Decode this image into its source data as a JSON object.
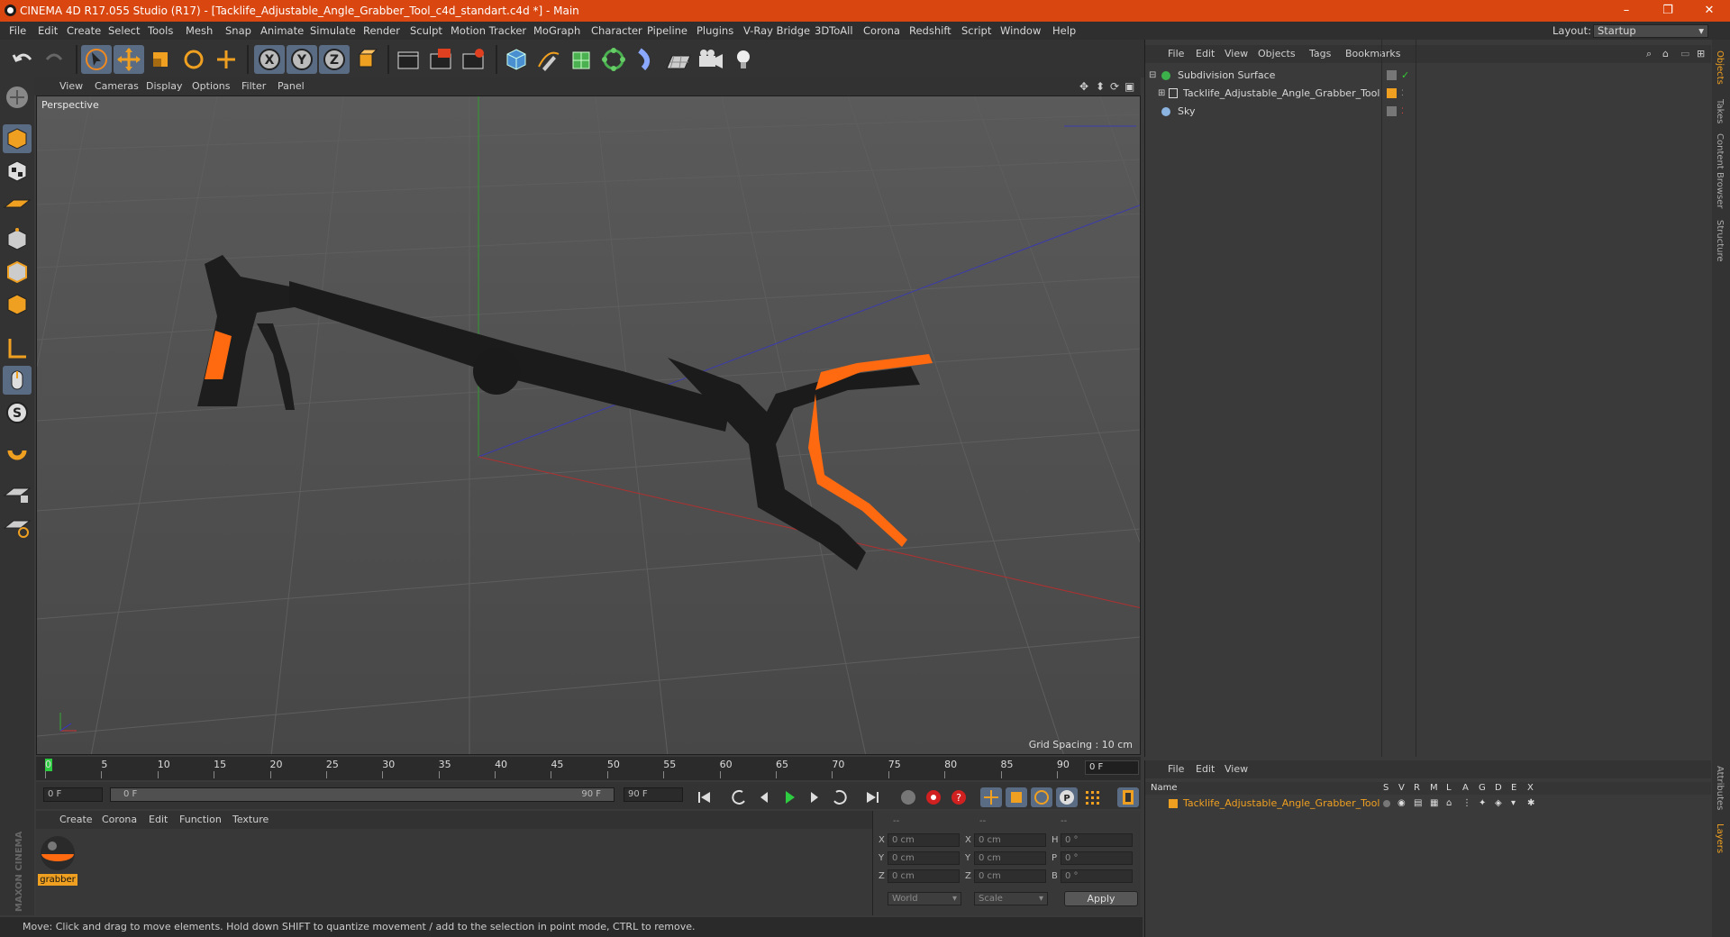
{
  "window": {
    "title": "CINEMA 4D R17.055 Studio (R17) - [Tacklife_Adjustable_Angle_Grabber_Tool_c4d_standart.c4d *] - Main",
    "minimize": "–",
    "restore": "❐",
    "close": "✕"
  },
  "menu": {
    "items": [
      "File",
      "Edit",
      "Create",
      "Select",
      "Tools",
      "Mesh",
      "Snap",
      "Animate",
      "Simulate",
      "Render",
      "Sculpt",
      "Motion Tracker",
      "MoGraph",
      "Character",
      "Pipeline",
      "Plugins",
      "V-Ray Bridge",
      "3DToAll",
      "Corona",
      "Redshift",
      "Script",
      "Window",
      "Help"
    ],
    "layout_label": "Layout:",
    "layout_value": "Startup"
  },
  "toolbar": {
    "icons": [
      "undo-icon",
      "redo-icon",
      "select-arrow-icon",
      "move-icon",
      "scale-icon",
      "rotate-icon",
      "last-tool-icon",
      "x-axis-icon",
      "y-axis-icon",
      "z-axis-icon",
      "coordinate-system-icon",
      "render-view-icon",
      "render-picture-viewer-icon",
      "render-settings-icon",
      "cube-icon",
      "pen-icon",
      "subdivision-icon",
      "array-icon",
      "deformer-icon",
      "floor-icon",
      "camera-icon",
      "light-icon"
    ],
    "axis_x": "X",
    "axis_y": "Y",
    "axis_z": "Z"
  },
  "viewport": {
    "menu": [
      "View",
      "Cameras",
      "Display",
      "Options",
      "Filter",
      "Panel"
    ],
    "label": "Perspective",
    "grid_spacing": "Grid Spacing : 10 cm"
  },
  "timeline": {
    "ticks": [
      "0",
      "5",
      "10",
      "15",
      "20",
      "25",
      "30",
      "35",
      "40",
      "45",
      "50",
      "55",
      "60",
      "65",
      "70",
      "75",
      "80",
      "85",
      "90"
    ],
    "current_frame": "0 F",
    "start_field": "0 F",
    "range_start": "0 F",
    "range_end": "90 F",
    "end_field": "90 F"
  },
  "materials": {
    "menu": [
      "Create",
      "Corona",
      "Edit",
      "Function",
      "Texture"
    ],
    "items": [
      {
        "name": "grabber"
      }
    ]
  },
  "coordinates": {
    "header": [
      "--",
      "--",
      "--"
    ],
    "rows": [
      {
        "a": "X",
        "av": "0 cm",
        "b": "X",
        "bv": "0 cm",
        "c": "H",
        "cv": "0 °"
      },
      {
        "a": "Y",
        "av": "0 cm",
        "b": "Y",
        "bv": "0 cm",
        "c": "P",
        "cv": "0 °"
      },
      {
        "a": "Z",
        "av": "0 cm",
        "b": "Z",
        "bv": "0 cm",
        "c": "B",
        "cv": "0 °"
      }
    ],
    "mode1": "World",
    "mode2": "Scale",
    "apply": "Apply"
  },
  "objects": {
    "menu": [
      "File",
      "Edit",
      "View",
      "Objects",
      "Tags",
      "Bookmarks"
    ],
    "rows": [
      {
        "name": "Subdivision Surface"
      },
      {
        "name": "Tacklife_Adjustable_Angle_Grabber_Tool"
      },
      {
        "name": "Sky"
      }
    ]
  },
  "layers": {
    "menu": [
      "File",
      "Edit",
      "View"
    ],
    "columns": [
      "Name",
      "S",
      "V",
      "R",
      "M",
      "L",
      "A",
      "G",
      "D",
      "E",
      "X"
    ],
    "rows": [
      {
        "name": "Tacklife_Adjustable_Angle_Grabber_Tool"
      }
    ]
  },
  "right_tabs": [
    "Objects",
    "Takes",
    "Content Browser",
    "Structure",
    "Attributes",
    "Layers"
  ],
  "branding": {
    "text": "MAXON CINEMA 4D"
  },
  "status": "Move: Click and drag to move elements. Hold down SHIFT to quantize movement / add to the selection in point mode, CTRL to remove.",
  "colors": {
    "accent": "#d9460f",
    "selection": "#f0a020",
    "model_orange": "#ff6a10"
  }
}
